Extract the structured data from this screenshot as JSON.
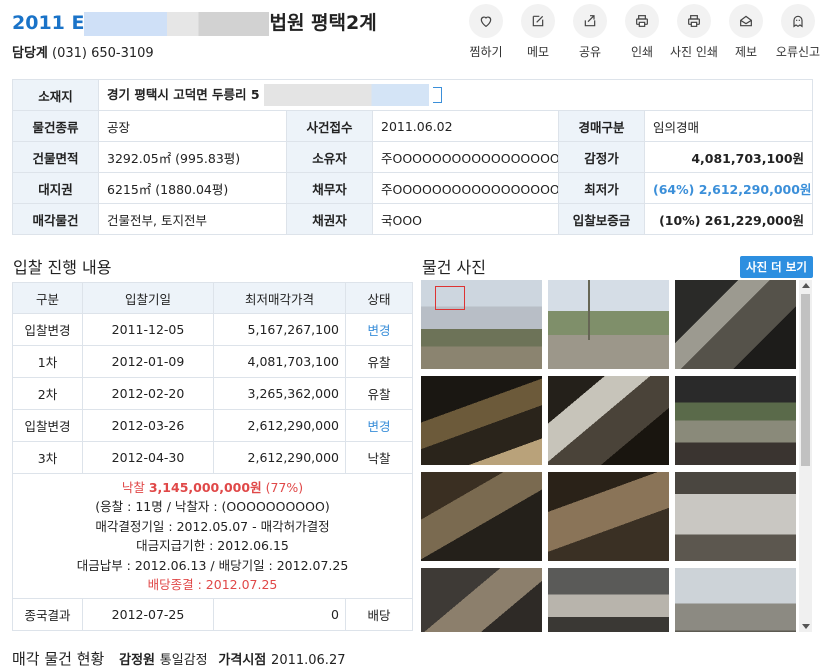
{
  "header": {
    "title_year": "2011 E",
    "title_rest": "법원 평택2계",
    "contact_label": "담당계",
    "contact_phone": "(031) 650-3109"
  },
  "actions": [
    {
      "label": "찜하기",
      "icon": "heart-icon"
    },
    {
      "label": "메모",
      "icon": "memo-icon"
    },
    {
      "label": "공유",
      "icon": "share-icon"
    },
    {
      "label": "인쇄",
      "icon": "print-icon"
    },
    {
      "label": "사진 인쇄",
      "icon": "photo-print-icon"
    },
    {
      "label": "제보",
      "icon": "report-icon"
    },
    {
      "label": "오류신고",
      "icon": "error-report-icon"
    }
  ],
  "info": {
    "location_label": "소재지",
    "location_value": "경기 평택시 고덕면 두릉리 5",
    "rows": [
      {
        "h1": "물건종류",
        "v1": "공장",
        "h2": "사건접수",
        "v2": "2011.06.02",
        "h3": "경매구분",
        "v3": "임의경매"
      },
      {
        "h1": "건물면적",
        "v1": "3292.05㎡ (995.83평)",
        "h2": "소유자",
        "v2": "주OOOOOOOOOOOOOOOOO...",
        "h3": "감정가",
        "v3": "4,081,703,100원"
      },
      {
        "h1": "대지권",
        "v1": "6215㎡ (1880.04평)",
        "h2": "채무자",
        "v2": "주OOOOOOOOOOOOOOOOO...",
        "h3": "최저가",
        "v3": "(64%) 2,612,290,000원"
      },
      {
        "h1": "매각물건",
        "v1": "건물전부, 토지전부",
        "h2": "채권자",
        "v2": "국OOO",
        "h3": "입찰보증금",
        "v3": "(10%) 261,229,000원"
      }
    ]
  },
  "bid_section_title": "입찰 진행 내용",
  "photo_section_title": "물건 사진",
  "photo_more_label": "사진 더 보기",
  "bid_table": {
    "headers": [
      "구분",
      "입찰기일",
      "최저매각가격",
      "상태"
    ],
    "rows": [
      {
        "round": "입찰변경",
        "date": "2011-12-05",
        "price": "5,167,267,100",
        "status": "변경"
      },
      {
        "round": "1차",
        "date": "2012-01-09",
        "price": "4,081,703,100",
        "status": "유찰"
      },
      {
        "round": "2차",
        "date": "2012-02-20",
        "price": "3,265,362,000",
        "status": "유찰"
      },
      {
        "round": "입찰변경",
        "date": "2012-03-26",
        "price": "2,612,290,000",
        "status": "변경"
      },
      {
        "round": "3차",
        "date": "2012-04-30",
        "price": "2,612,290,000",
        "status": "낙찰"
      }
    ],
    "summary": {
      "sold_label": "낙찰",
      "sold_price": "3,145,000,000원",
      "sold_rate": "(77%)",
      "line2": "(응찰 : 11명 / 낙찰자 : (OOOOOOOOOO)",
      "line3": "매각결정기일 : 2012.05.07 - 매각허가결정",
      "line4": "대금지급기한 : 2012.06.15",
      "line5": "대금납부 : 2012.06.13 / 배당기일 : 2012.07.25",
      "line6": "배당종결 : 2012.07.25"
    },
    "final": {
      "round": "종국결과",
      "date": "2012-07-25",
      "price": "0",
      "status": "배당"
    }
  },
  "bottom": {
    "title": "매각 물건 현황",
    "appraiser_label": "감정원",
    "appraiser_value": "통일감정",
    "price_point_label": "가격시점",
    "price_point_value": "2011.06.27"
  },
  "colors": {
    "accent": "#1a73c8",
    "link": "#3b8fd9",
    "sold": "#e04848",
    "header_bg": "#edf3f9",
    "button": "#2d8fe0"
  }
}
